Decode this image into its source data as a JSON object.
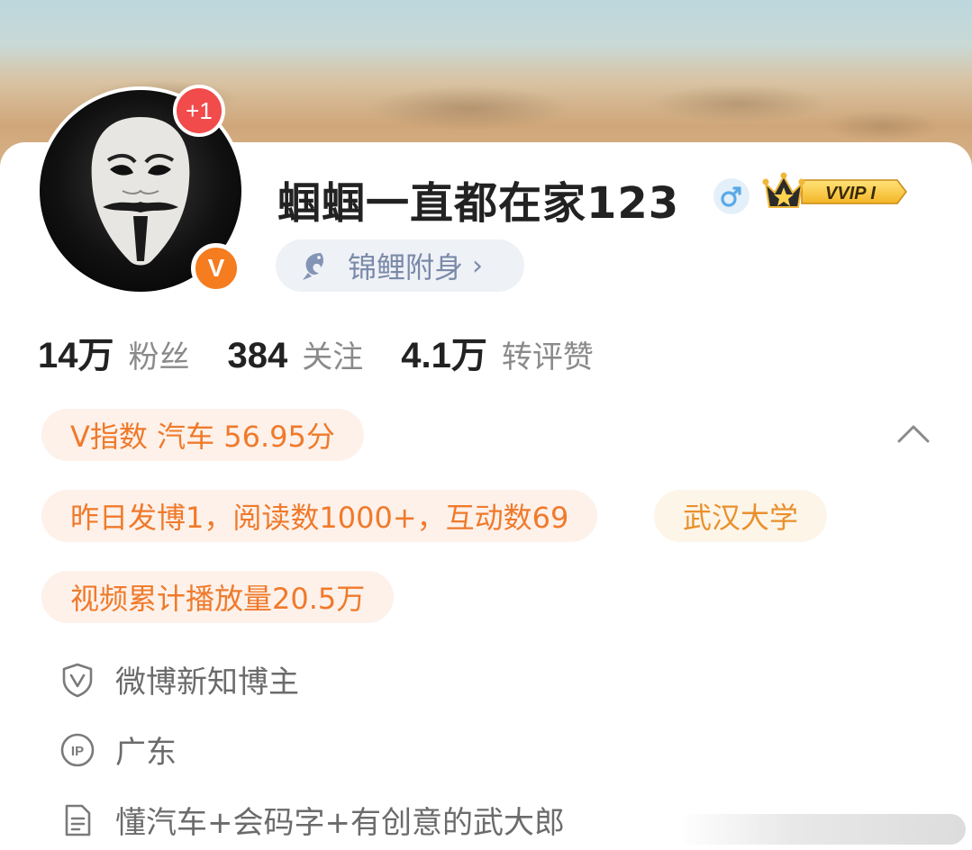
{
  "header": {
    "notification_count": "+1",
    "verified_mark": "V",
    "username": "蝈蝈一直都在家123",
    "gender_icon": "male-icon",
    "vip_badge": "VVIP I",
    "lucky_label": "锦鲤附身",
    "lucky_chevron": "›"
  },
  "stats": [
    {
      "number": "14万",
      "label": "粉丝"
    },
    {
      "number": "384",
      "label": "关注"
    },
    {
      "number": "4.1万",
      "label": "转评赞"
    }
  ],
  "tags": {
    "v_index": "V指数 汽车 56.95分",
    "yesterday": "昨日发博1，阅读数1000+，互动数69",
    "school": "武汉大学",
    "video": "视频累计播放量20.5万"
  },
  "info": {
    "certification": "微博新知博主",
    "ip_location": "广东",
    "bio": "懂汽车+会码字+有创意的武大郎"
  },
  "colors": {
    "accent_orange": "#f07a2b",
    "verified_orange": "#f57c1f",
    "notification_red": "#f24b4b",
    "gender_blue": "#5aa9e6"
  }
}
